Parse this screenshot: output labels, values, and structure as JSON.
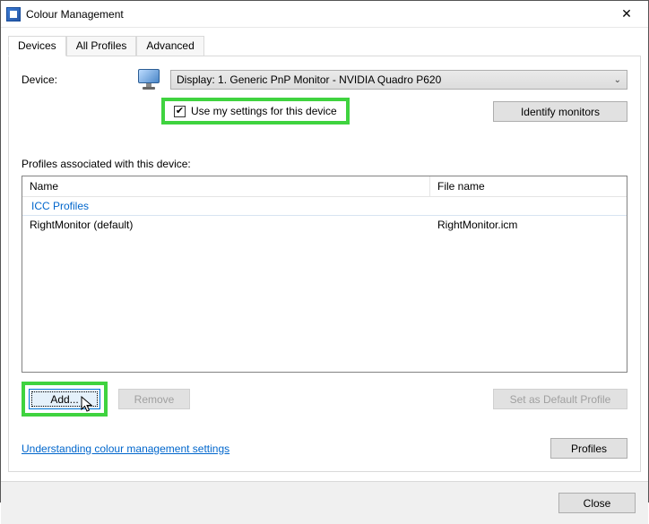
{
  "window": {
    "title": "Colour Management",
    "close_label": "✕"
  },
  "tabs": {
    "devices": "Devices",
    "all_profiles": "All Profiles",
    "advanced": "Advanced"
  },
  "device": {
    "label": "Device:",
    "selected": "Display: 1. Generic PnP Monitor - NVIDIA Quadro P620",
    "use_settings_label": "Use my settings for this device",
    "use_settings_checked": true,
    "identify_label": "Identify monitors"
  },
  "profiles": {
    "section_label": "Profiles associated with this device:",
    "columns": {
      "name": "Name",
      "file": "File name"
    },
    "group_header": "ICC Profiles",
    "rows": [
      {
        "name": "RightMonitor (default)",
        "file": "RightMonitor.icm"
      }
    ]
  },
  "buttons": {
    "add": "Add...",
    "remove": "Remove",
    "set_default": "Set as Default Profile",
    "profiles": "Profiles",
    "close": "Close"
  },
  "link": {
    "understanding": "Understanding colour management settings"
  }
}
